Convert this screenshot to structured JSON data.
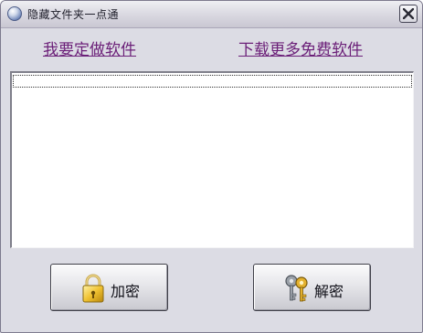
{
  "window": {
    "title": "隐藏文件夹一点通"
  },
  "links": {
    "custom_software": "我要定做软件",
    "more_free_software": "下载更多免费软件"
  },
  "list": {
    "rows": [
      ""
    ]
  },
  "buttons": {
    "encrypt_label": "加密",
    "decrypt_label": "解密"
  },
  "icons": {
    "app": "app-globe-icon",
    "close": "close-icon",
    "encrypt": "padlock-icon",
    "decrypt": "keys-icon"
  },
  "colors": {
    "link": "#6b1f78",
    "window_bg": "#dcdce4",
    "titlebar": "#dcdbe3"
  }
}
